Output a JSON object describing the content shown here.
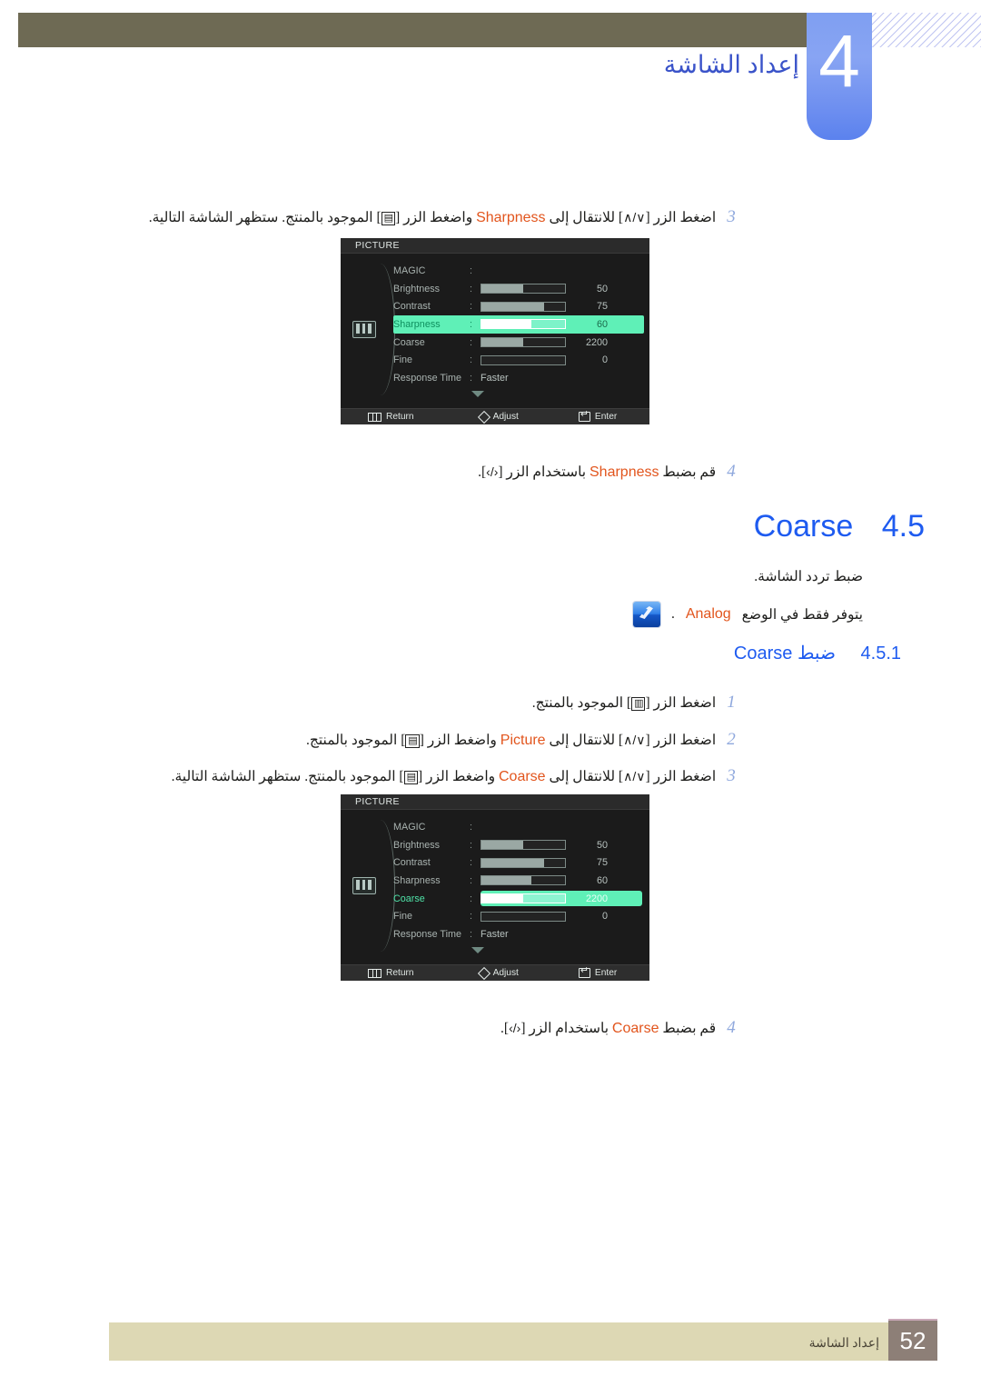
{
  "header": {
    "chapter_number": "4",
    "chapter_title": "إعداد الشاشة"
  },
  "steps_sharpness": [
    {
      "number": "3",
      "text_before_kw": "اضغط الزر [",
      "btn1": "∧/∨",
      "text_mid": "] للانتقال إلى",
      "keyword": "Sharpness",
      "text_after": "واضغط الزر [",
      "btn2": "⬚",
      "text_end": "] الموجود بالمنتج. ستظهر الشاشة التالية.",
      "full": "اضغط الزر [∧/∨] للانتقال إلى Sharpness واضغط الزر [] الموجود بالمنتج. ستظهر الشاشة التالية."
    },
    {
      "number": "4",
      "text_start": "قم بضبط",
      "keyword": "Sharpness",
      "text_mid": "باستخدام الزر [",
      "btn": "‹/›",
      "text_end": "]."
    }
  ],
  "osd_sharpness": {
    "title": "PICTURE",
    "rows": [
      {
        "label": "MAGIC",
        "type": "empty",
        "value": "",
        "fill_pct": 0
      },
      {
        "label": "Brightness",
        "type": "bar",
        "value": "50",
        "fill_pct": 50
      },
      {
        "label": "Contrast",
        "type": "bar",
        "value": "75",
        "fill_pct": 75
      },
      {
        "label": "Sharpness",
        "type": "bar",
        "value": "60",
        "fill_pct": 60,
        "highlight": true
      },
      {
        "label": "Coarse",
        "type": "bar",
        "value": "2200",
        "fill_pct": 50
      },
      {
        "label": "Fine",
        "type": "bar",
        "value": "0",
        "fill_pct": 0
      },
      {
        "label": "Response Time",
        "type": "text",
        "value": "Faster",
        "fill_pct": 0
      }
    ],
    "footer": {
      "return": "Return",
      "adjust": "Adjust",
      "enter": "Enter"
    }
  },
  "section_coarse": {
    "number": "4.5",
    "title": "Coarse",
    "description": "ضبط تردد الشاشة.",
    "note": "يتوفر فقط في الوضع",
    "note_keyword": "Analog",
    "note_end": "."
  },
  "section_coarse_adjust": {
    "number": "4.5.1",
    "title_en": "Coarse",
    "title_ar": "ضبط"
  },
  "steps_coarse": [
    {
      "number": "1",
      "text_start": "اضغط الزر [",
      "btn": "‖‖",
      "text_end": "] الموجود بالمنتج."
    },
    {
      "number": "2",
      "text_start": "اضغط الزر [",
      "btn1": "∧/∨",
      "text_mid": "] للانتقال إلى",
      "keyword": "Picture",
      "text_after": "واضغط الزر [",
      "btn2": "⬚",
      "text_end": "] الموجود بالمنتج."
    },
    {
      "number": "3",
      "text_start": "اضغط الزر [",
      "btn1": "∧/∨",
      "text_mid": "] للانتقال إلى",
      "keyword": "Coarse",
      "text_after": "واضغط الزر [",
      "btn2": "⬚",
      "text_end": "] الموجود بالمنتج. ستظهر الشاشة التالية."
    },
    {
      "number": "4",
      "text_start": "قم بضبط",
      "keyword": "Coarse",
      "text_mid": "باستخدام الزر [",
      "btn": "‹/›",
      "text_end": "]."
    }
  ],
  "osd_coarse": {
    "title": "PICTURE",
    "rows": [
      {
        "label": "MAGIC",
        "type": "empty",
        "value": "",
        "fill_pct": 0
      },
      {
        "label": "Brightness",
        "type": "bar",
        "value": "50",
        "fill_pct": 50
      },
      {
        "label": "Contrast",
        "type": "bar",
        "value": "75",
        "fill_pct": 75
      },
      {
        "label": "Sharpness",
        "type": "bar",
        "value": "60",
        "fill_pct": 60
      },
      {
        "label": "Coarse",
        "type": "bar",
        "value": "2200",
        "fill_pct": 50,
        "highlight": true
      },
      {
        "label": "Fine",
        "type": "bar",
        "value": "0",
        "fill_pct": 0
      },
      {
        "label": "Response Time",
        "type": "text",
        "value": "Faster",
        "fill_pct": 0
      }
    ],
    "footer": {
      "return": "Return",
      "adjust": "Adjust",
      "enter": "Enter"
    }
  },
  "footer": {
    "page_number": "52",
    "text": "إعداد الشاشة"
  },
  "colors": {
    "header_bar": "#6e6a54",
    "chapter_tab": "#7f9ff2",
    "heading_blue": "#1e5bf0",
    "keyword_orange": "#e2551d",
    "step_number": "#8fa8dd",
    "osd_bg": "#1b1b1b",
    "osd_highlight": "#5ff0b7",
    "footer_band": "#ddd8b4",
    "page_box": "#8d7f77"
  }
}
